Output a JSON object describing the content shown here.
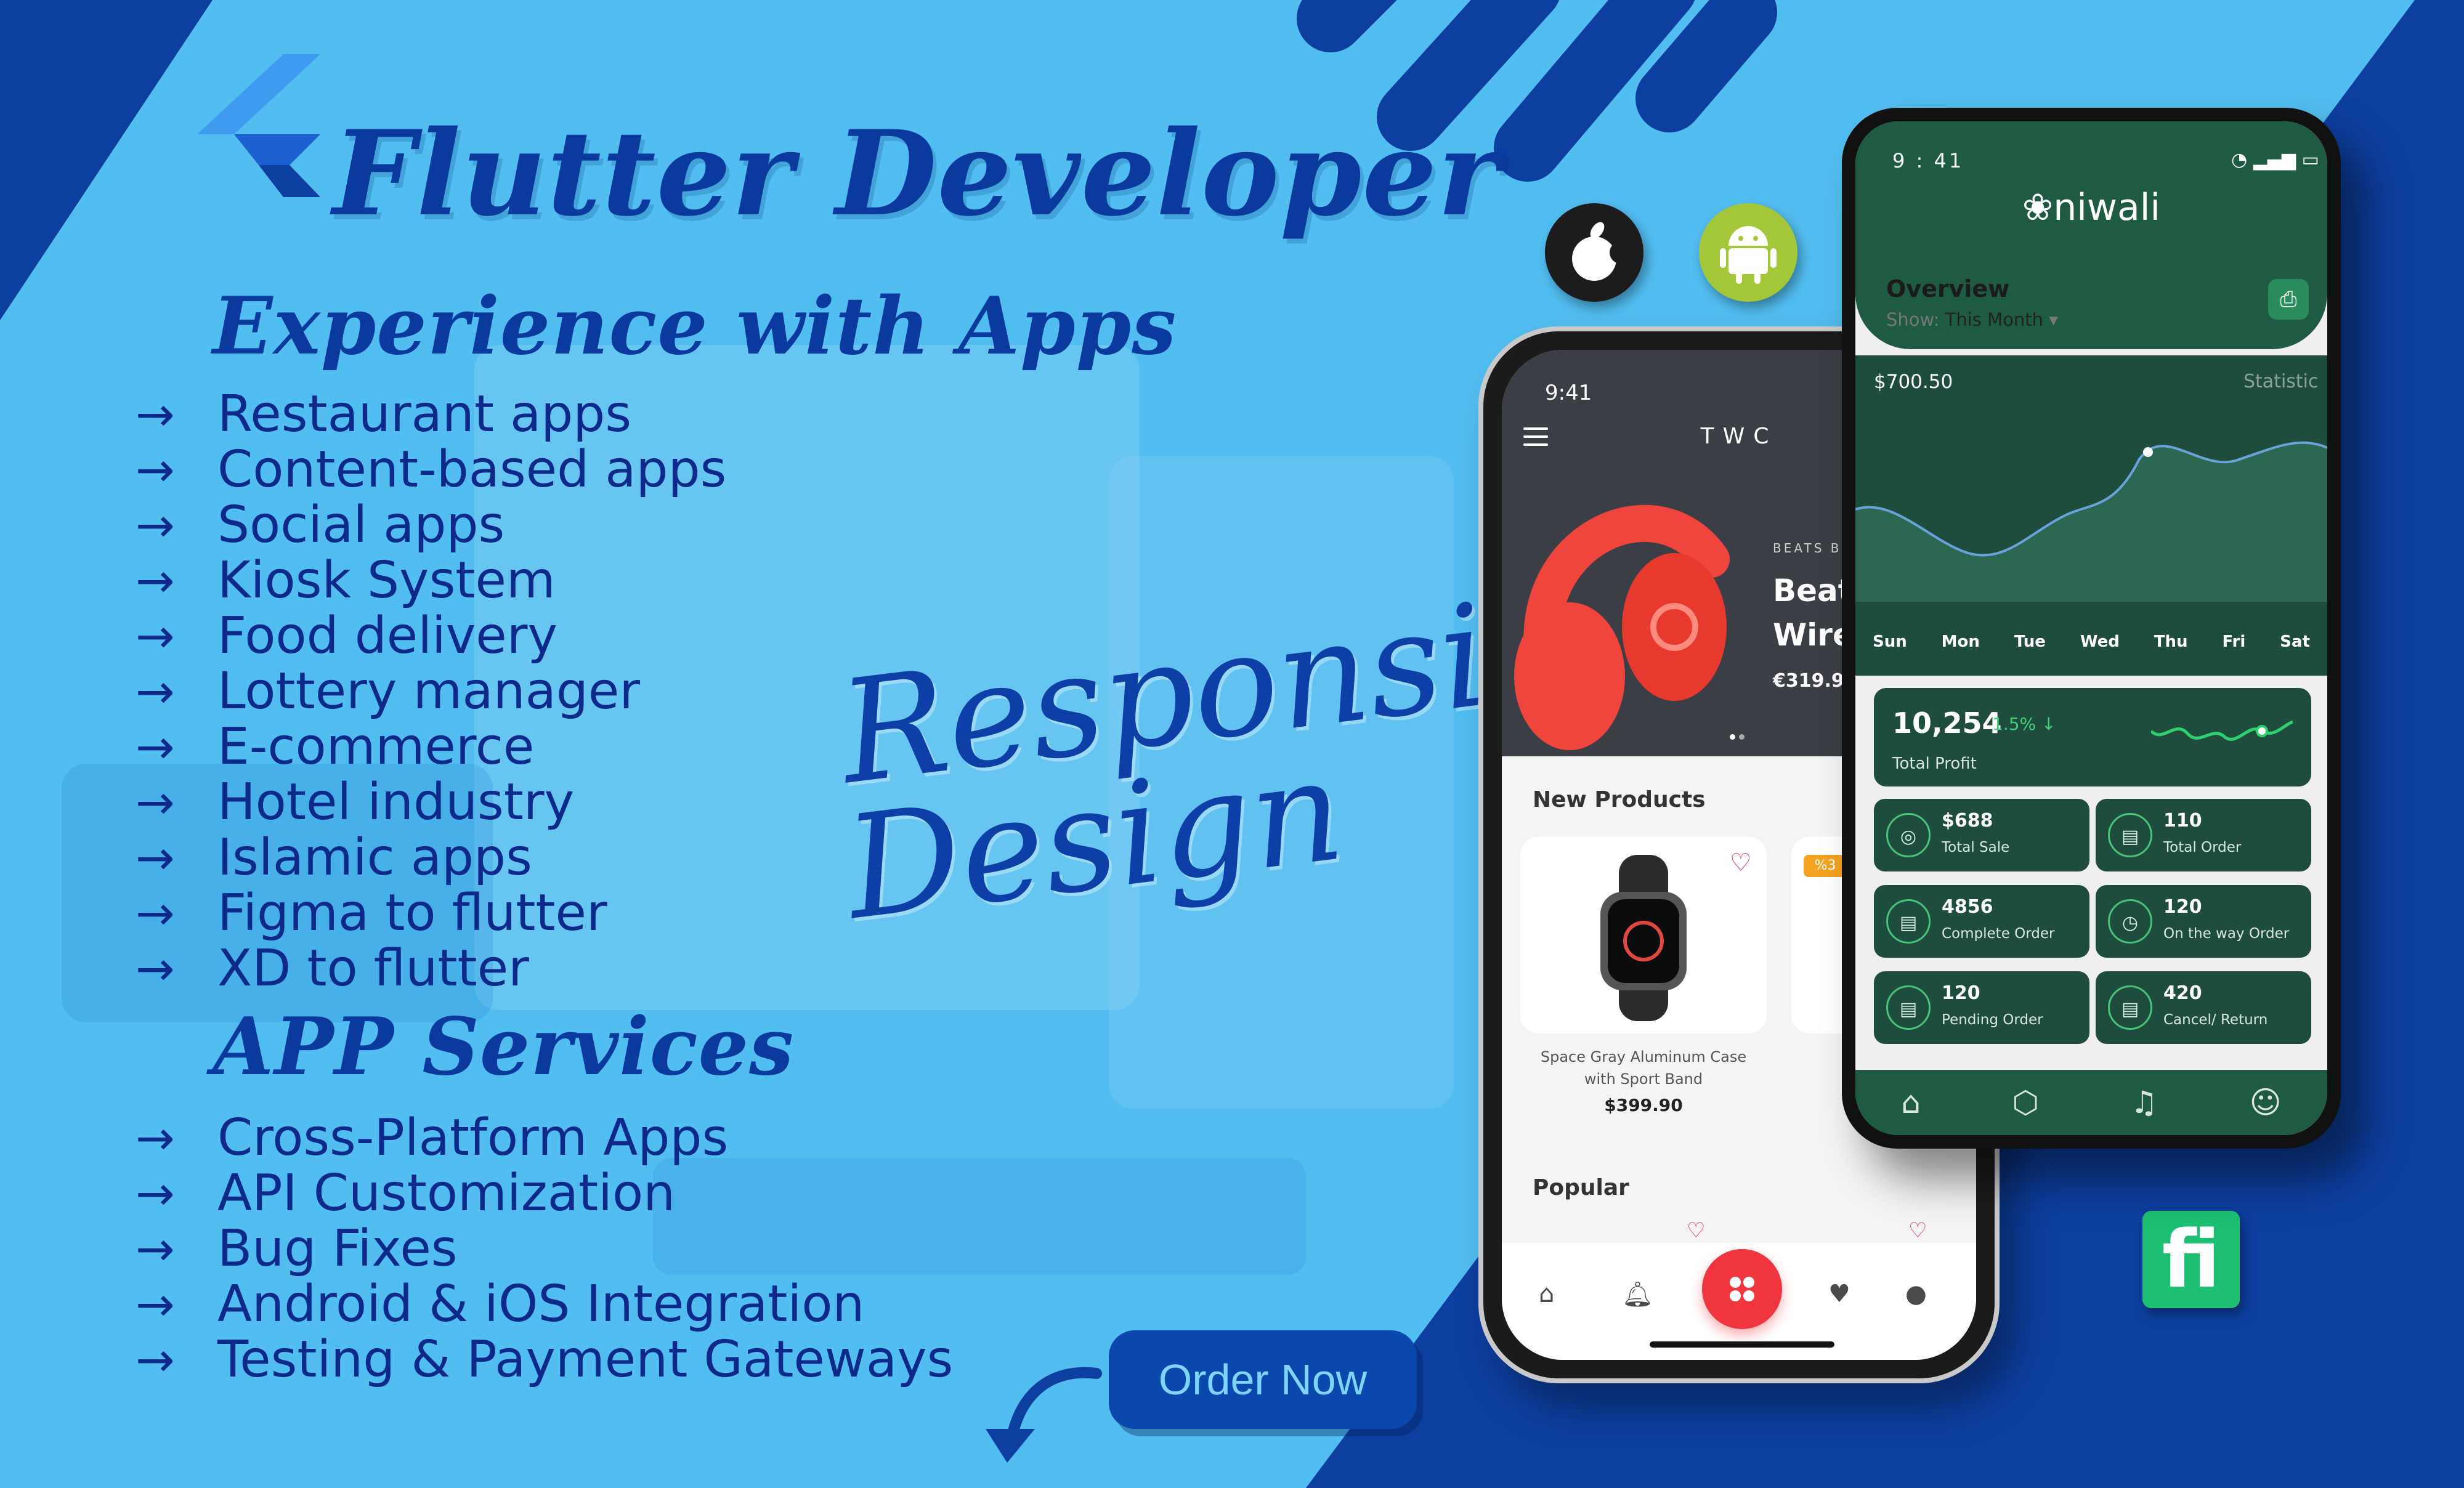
{
  "hero": {
    "title": "Flutter Developer",
    "experience_title": "Experience with Apps",
    "services_title": "APP Services",
    "tagline_line1": "Responsive",
    "tagline_line2": "Design",
    "order_button": "Order Now"
  },
  "experience": [
    "Restaurant apps",
    "Content-based apps",
    "Social apps",
    "Kiosk System",
    "Food delivery",
    "Lottery manager",
    "E-commerce",
    "Hotel industry",
    "Islamic apps",
    "Figma to flutter",
    "XD to flutter"
  ],
  "services": [
    "Cross-Platform Apps",
    "API Customization",
    "Bug Fixes",
    "Android & iOS Integration",
    "Testing & Payment Gateways"
  ],
  "colors": {
    "background": "#52bdf0",
    "headline": "#0b3a9e",
    "accent": "#0b48ad",
    "niwali_green": "#1f5a43"
  },
  "shop_app": {
    "time": "9:41",
    "brand": "TWC",
    "promo_kicker": "BEATS B",
    "promo_line1": "Beat",
    "promo_line2": "Wire",
    "promo_price": "€319.9(",
    "new_products": "New Products",
    "offer_badge": "%3",
    "product_line1": "Space Gray Aluminum Case",
    "product_line2": "with Sport Band",
    "product_price": "$399.90",
    "popular": "Popular"
  },
  "dashboard_app": {
    "time": "9 : 41",
    "logo": "niwali",
    "overview": "Overview",
    "show_label": "Show:",
    "show_value": "This Month",
    "chart_amount": "$700.50",
    "chart_label": "Statistic",
    "days": [
      "Sun",
      "Mon",
      "Tue",
      "Wed",
      "Thu",
      "Fri",
      "Sat"
    ],
    "profit_value": "10,254",
    "profit_change": "1.5% ↓",
    "profit_label": "Total Profit",
    "tiles": [
      {
        "value": "$688",
        "label": "Total Sale"
      },
      {
        "value": "110",
        "label": "Total Order"
      },
      {
        "value": "4856",
        "label": "Complete Order"
      },
      {
        "value": "120",
        "label": "On the way Order"
      },
      {
        "value": "120",
        "label": "Pending Order"
      },
      {
        "value": "420",
        "label": "Cancel/ Return"
      }
    ]
  }
}
